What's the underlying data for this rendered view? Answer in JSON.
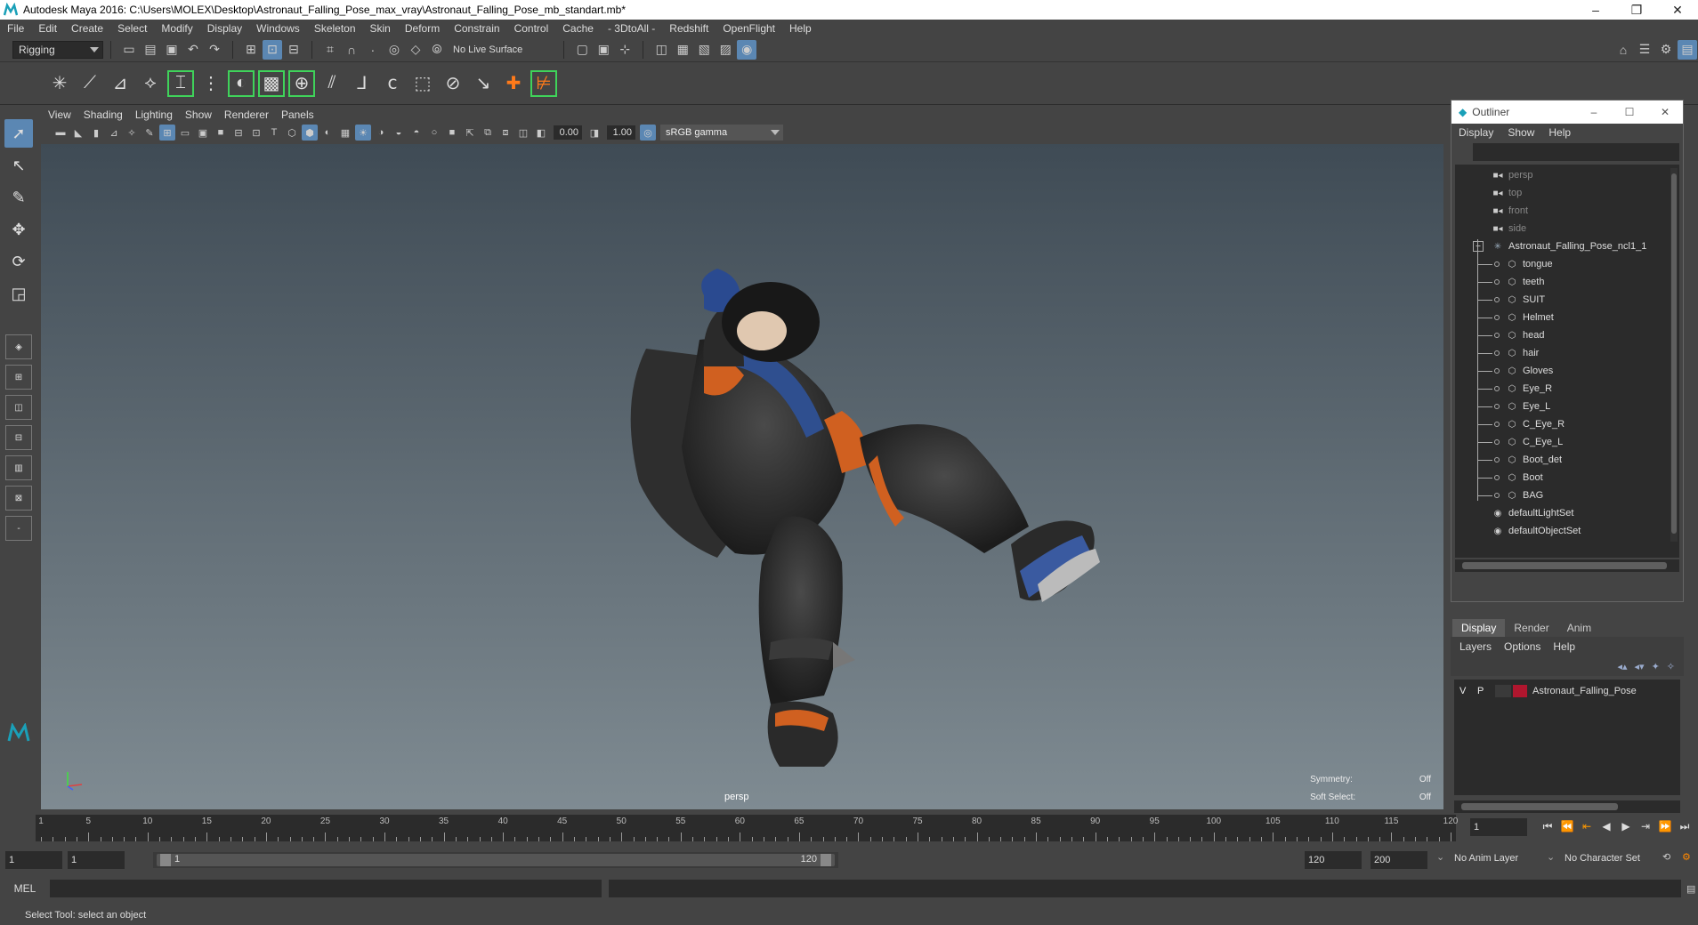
{
  "window": {
    "title": "Autodesk Maya 2016: C:\\Users\\MOLEX\\Desktop\\Astronaut_Falling_Pose_max_vray\\Astronaut_Falling_Pose_mb_standart.mb*",
    "minimize": "–",
    "restore": "❐",
    "close": "✕"
  },
  "menubar": [
    "File",
    "Edit",
    "Create",
    "Select",
    "Modify",
    "Display",
    "Windows",
    "Skeleton",
    "Skin",
    "Deform",
    "Constrain",
    "Control",
    "Cache",
    "- 3DtoAll -",
    "Redshift",
    "OpenFlight",
    "Help"
  ],
  "statusline": {
    "menuset": "Rigging",
    "live_surface": "No Live Surface"
  },
  "panel": {
    "menu": [
      "View",
      "Shading",
      "Lighting",
      "Show",
      "Renderer",
      "Panels"
    ],
    "exposure": "0.00",
    "gamma": "1.00",
    "color_space": "sRGB gamma",
    "camera": "persp",
    "hud": {
      "symmetry_label": "Symmetry:",
      "symmetry_value": "Off",
      "soft_select_label": "Soft Select:",
      "soft_select_value": "Off"
    }
  },
  "outliner": {
    "title": "Outliner",
    "menu": [
      "Display",
      "Show",
      "Help"
    ],
    "cameras": [
      "persp",
      "top",
      "front",
      "side"
    ],
    "root": "Astronaut_Falling_Pose_ncl1_1",
    "children": [
      "tongue",
      "teeth",
      "SUIT",
      "Helmet",
      "head",
      "hair",
      "Gloves",
      "Eye_R",
      "Eye_L",
      "C_Eye_R",
      "C_Eye_L",
      "Boot_det",
      "Boot",
      "BAG"
    ],
    "sets": [
      "defaultLightSet",
      "defaultObjectSet"
    ]
  },
  "layer_editor": {
    "tabs": [
      "Display",
      "Render",
      "Anim"
    ],
    "menu": [
      "Layers",
      "Options",
      "Help"
    ],
    "layer": {
      "v": "V",
      "p": "P",
      "name": "Astronaut_Falling_Pose",
      "color": "#b0162e"
    }
  },
  "timeslider": {
    "labels": [
      "1",
      "5",
      "10",
      "15",
      "20",
      "25",
      "30",
      "35",
      "40",
      "45",
      "50",
      "55",
      "60",
      "65",
      "70",
      "75",
      "80",
      "85",
      "90",
      "95",
      "100",
      "105",
      "110",
      "115",
      "120"
    ],
    "current_frame": "1"
  },
  "range": {
    "start": "1",
    "playback_start": "1",
    "slider_start": "1",
    "slider_end": "120",
    "playback_end": "120",
    "end": "200",
    "anim_layer": "No Anim Layer",
    "character_set": "No Character Set"
  },
  "cmdline": {
    "label": "MEL"
  },
  "helpline": {
    "text": "Select Tool: select an object"
  }
}
